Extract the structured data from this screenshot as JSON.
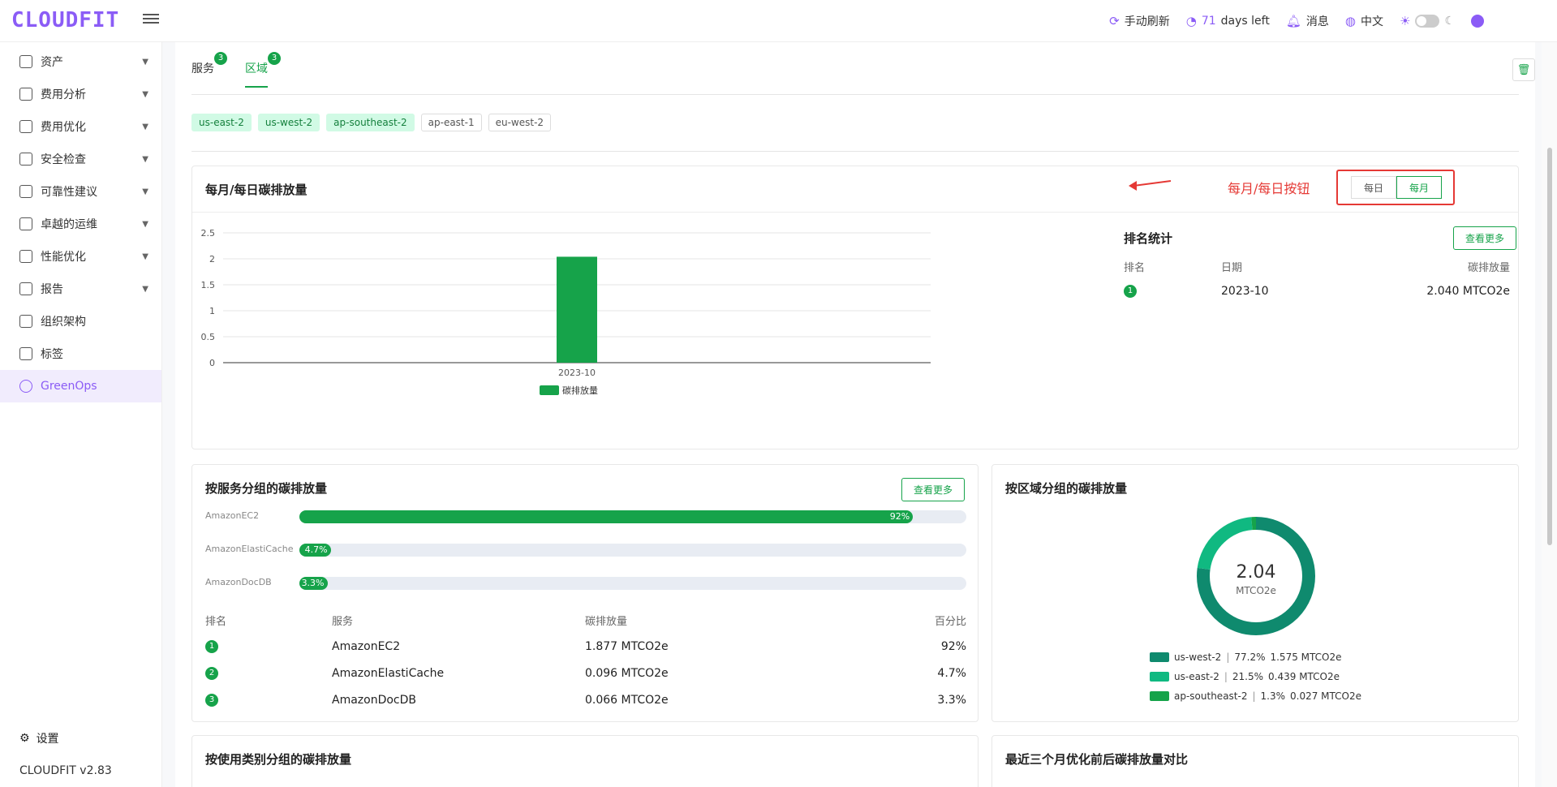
{
  "header": {
    "logo": "CLOUDFIT",
    "refresh_label": "手动刷新",
    "days_num": "71",
    "days_text": "days left",
    "messages_label": "消息",
    "language_label": "中文"
  },
  "sidebar": {
    "items": [
      {
        "label": "资产",
        "icon": "asset-icon",
        "expandable": true
      },
      {
        "label": "费用分析",
        "icon": "dashboard-icon",
        "expandable": true
      },
      {
        "label": "费用优化",
        "icon": "dollar-icon",
        "expandable": true
      },
      {
        "label": "安全检查",
        "icon": "alarm-icon",
        "expandable": true
      },
      {
        "label": "可靠性建议",
        "icon": "document-icon",
        "expandable": true
      },
      {
        "label": "卓越的运维",
        "icon": "cloud-icon",
        "expandable": true
      },
      {
        "label": "性能优化",
        "icon": "grid-icon",
        "expandable": true
      },
      {
        "label": "报告",
        "icon": "report-icon",
        "expandable": true
      },
      {
        "label": "组织架构",
        "icon": "org-icon",
        "expandable": false
      },
      {
        "label": "标签",
        "icon": "tag-icon",
        "expandable": false
      },
      {
        "label": "GreenOps",
        "icon": "greenops-icon",
        "expandable": false,
        "active": true
      }
    ],
    "settings_label": "设置",
    "version": "CLOUDFIT v2.83"
  },
  "tabs": [
    {
      "label": "服务",
      "count": "3"
    },
    {
      "label": "区域",
      "count": "3",
      "active": true
    }
  ],
  "regions": [
    {
      "label": "us-east-2",
      "selected": true
    },
    {
      "label": "us-west-2",
      "selected": true
    },
    {
      "label": "ap-southeast-2",
      "selected": true
    },
    {
      "label": "ap-east-1",
      "selected": false
    },
    {
      "label": "eu-west-2",
      "selected": false
    }
  ],
  "emissions": {
    "title": "每月/每日碳排放量",
    "annotation": "每月/每日按钮",
    "daily_label": "每日",
    "monthly_label": "每月",
    "ranking": {
      "title": "排名统计",
      "more_label": "查看更多",
      "headers": [
        "排名",
        "日期",
        "碳排放量"
      ],
      "rows": [
        {
          "rank": "1",
          "date": "2023-10",
          "value": "2.040 MTCO2e"
        }
      ]
    }
  },
  "chart_data": {
    "type": "bar",
    "categories": [
      "2023-10"
    ],
    "series": [
      {
        "name": "碳排放量",
        "values": [
          2.04
        ]
      }
    ],
    "yticks": [
      "0",
      "0.5",
      "1",
      "1.5",
      "2",
      "2.5"
    ],
    "ylim": [
      0,
      2.5
    ],
    "legend": "bottom",
    "grid": true,
    "color": "#16a34a"
  },
  "service": {
    "title": "按服务分组的碳排放量",
    "more_label": "查看更多",
    "bars": [
      {
        "label": "AmazonEC2",
        "percent": 92,
        "text": "92%"
      },
      {
        "label": "AmazonElastiCache",
        "percent": 4.7,
        "text": "4.7%"
      },
      {
        "label": "AmazonDocDB",
        "percent": 3.3,
        "text": "3.3%"
      }
    ],
    "headers": [
      "排名",
      "服务",
      "碳排放量",
      "百分比"
    ],
    "rows": [
      {
        "rank": "1",
        "service": "AmazonEC2",
        "value": "1.877 MTCO2e",
        "pct": "92%"
      },
      {
        "rank": "2",
        "service": "AmazonElastiCache",
        "value": "0.096 MTCO2e",
        "pct": "4.7%"
      },
      {
        "rank": "3",
        "service": "AmazonDocDB",
        "value": "0.066 MTCO2e",
        "pct": "3.3%"
      }
    ]
  },
  "region_group": {
    "title": "按区域分组的碳排放量",
    "total": "2.04",
    "unit": "MTCO2e",
    "slices": [
      {
        "name": "us-west-2",
        "pct": "77.2%",
        "value": "1.575 MTCO2e",
        "fraction": 0.772,
        "color": "#0f8a6e"
      },
      {
        "name": "us-east-2",
        "pct": "21.5%",
        "value": "0.439 MTCO2e",
        "fraction": 0.215,
        "color": "#10b981"
      },
      {
        "name": "ap-southeast-2",
        "pct": "1.3%",
        "value": "0.027 MTCO2e",
        "fraction": 0.013,
        "color": "#16a34a"
      }
    ]
  },
  "usage": {
    "title": "按使用类别分组的碳排放量"
  },
  "compare": {
    "title": "最近三个月优化前后碳排放量对比"
  }
}
